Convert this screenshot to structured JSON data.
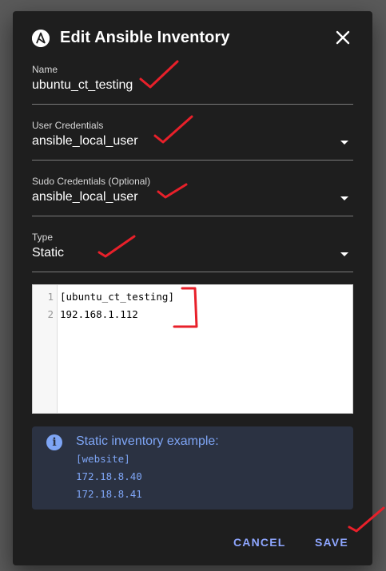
{
  "dialog": {
    "title": "Edit Ansible Inventory",
    "logo_letter": "A"
  },
  "fields": {
    "name": {
      "label": "Name",
      "value": "ubuntu_ct_testing"
    },
    "user_credentials": {
      "label": "User Credentials",
      "value": "ansible_local_user"
    },
    "sudo_credentials": {
      "label": "Sudo Credentials (Optional)",
      "value": "ansible_local_user"
    },
    "type": {
      "label": "Type",
      "value": "Static"
    }
  },
  "editor": {
    "lines": [
      {
        "num": "1",
        "text": "[ubuntu_ct_testing]"
      },
      {
        "num": "2",
        "text": "192.168.1.112"
      }
    ]
  },
  "info": {
    "icon_glyph": "i",
    "title": "Static inventory example:",
    "lines": [
      "[website]",
      "172.18.8.40",
      "172.18.8.41"
    ]
  },
  "actions": {
    "cancel": "CANCEL",
    "save": "SAVE"
  },
  "colors": {
    "dialog_bg": "#1e1e1e",
    "accent": "#8ea6ff",
    "info_bg": "#2b3242",
    "annotation": "#e8202a"
  }
}
